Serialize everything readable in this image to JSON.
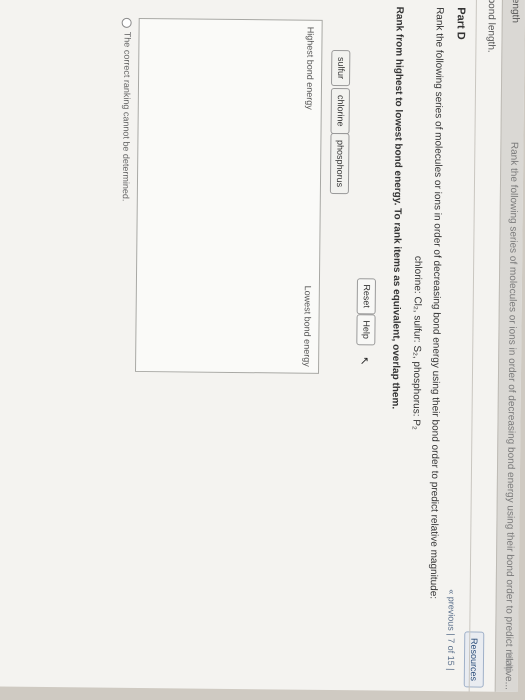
{
  "header": {
    "left_text": "ength",
    "title_text": "Rank the following series of molecules or ions in order of decreasing bond energy using their bond order to predict relative...",
    "help_label": "Help"
  },
  "nav": {
    "resources_label": "Resources",
    "pager_text": "« previous | 7 of 15 |"
  },
  "page": {
    "title": "bond length."
  },
  "part": {
    "label": "Part D",
    "instructions": "Rank the following series of molecules or ions in order of decreasing bond energy using their bond order to predict relative magnitude:",
    "formula_line": "chlorine: Cl₂, sulfur: S₂, phosphorus: P₂",
    "rank_directions": "Rank from highest to lowest bond energy. To rank items as equivalent, overlap them."
  },
  "toolbar": {
    "reset_label": "Reset",
    "help_label": "Help"
  },
  "items": [
    "sulfur",
    "chlorine",
    "phosphorus"
  ],
  "ranking": {
    "highest_label": "Highest bond energy",
    "lowest_label": "Lowest bond energy"
  },
  "option": {
    "cannot_determine": "The correct ranking cannot be determined."
  }
}
